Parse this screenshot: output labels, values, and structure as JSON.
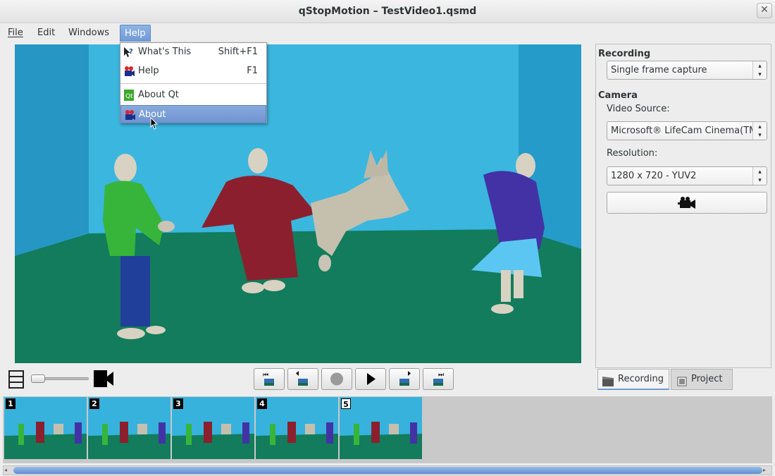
{
  "window": {
    "title": "qStopMotion – TestVideo1.qsmd",
    "close_glyph": "✕"
  },
  "menubar": {
    "items": [
      {
        "label": "File"
      },
      {
        "label": "Edit"
      },
      {
        "label": "Windows"
      },
      {
        "label": "Help",
        "active": true
      }
    ]
  },
  "help_menu": {
    "items": [
      {
        "label": "What's This",
        "shortcut": "Shift+F1",
        "icon": "whats-this-icon"
      },
      {
        "label": "Help",
        "shortcut": "F1",
        "icon": "qstopmotion-icon"
      },
      {
        "label": "About Qt",
        "shortcut": "",
        "icon": "qt-logo-icon"
      },
      {
        "label": "About",
        "shortcut": "",
        "icon": "qstopmotion-icon",
        "highlighted": true
      }
    ]
  },
  "preview": {
    "description_icon": "live-camera-preview"
  },
  "playback": {
    "buttons": [
      {
        "name": "first-frame-button",
        "glyph": "⏮"
      },
      {
        "name": "previous-frame-button",
        "glyph": "◀"
      },
      {
        "name": "record-button",
        "glyph": "●"
      },
      {
        "name": "play-button",
        "glyph": "▶"
      },
      {
        "name": "next-frame-button",
        "glyph": "▶"
      },
      {
        "name": "last-frame-button",
        "glyph": "⏭"
      }
    ]
  },
  "mix_slider": {
    "value_percent": 0
  },
  "right_panel": {
    "recording_title": "Recording",
    "recording_mode": "Single frame capture",
    "camera_title": "Camera",
    "video_source_label": "Video Source:",
    "video_source": "Microsoft® LifeCam Cinema(TM)",
    "resolution_label": "Resolution:",
    "resolution": "1280 x 720 - YUV2",
    "camera_button_icon": "video-camera-icon"
  },
  "tabs": [
    {
      "label": "Recording",
      "active": true
    },
    {
      "label": "Project",
      "active": false
    }
  ],
  "frames": [
    {
      "number": "1"
    },
    {
      "number": "2"
    },
    {
      "number": "3"
    },
    {
      "number": "4"
    },
    {
      "number": "5",
      "selected": true
    }
  ],
  "colors": {
    "wall": "#2aa6d2",
    "floor": "#127c5c",
    "menu_highlight": "#6f99d6"
  }
}
